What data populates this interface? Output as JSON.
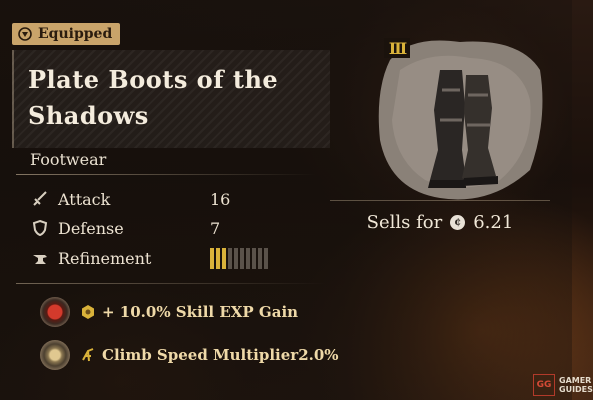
{
  "item": {
    "status_badge": "Equipped",
    "name": "Plate Boots of the Shadows",
    "tier_badge": "III",
    "category": "Footwear",
    "stats": [
      {
        "label": "Attack",
        "value": "16",
        "icon": "sword-icon"
      },
      {
        "label": "Defense",
        "value": "7",
        "icon": "shield-icon"
      },
      {
        "label": "Refinement",
        "icon": "anvil-icon"
      }
    ],
    "refinement": {
      "level": 3,
      "max": 10
    },
    "sells_for": {
      "label": "Sells for",
      "value": "6.21",
      "icon": "coin-icon"
    },
    "effects": [
      {
        "text": "+ 10.0% Skill EXP Gain",
        "orb_icon": "red-gem-orb-icon",
        "small_icon": "hexagon-gold-icon"
      },
      {
        "text": "Climb Speed Multiplier2.0%",
        "orb_icon": "gold-relic-orb-icon",
        "small_icon": "climb-icon"
      }
    ]
  },
  "watermark": {
    "logo": "GG",
    "line1": "GAMER",
    "line2": "GUIDES"
  },
  "colors": {
    "accent_gold": "#d9b23a",
    "badge_bg": "#c9a46a",
    "panel_bg": "#16100c"
  }
}
